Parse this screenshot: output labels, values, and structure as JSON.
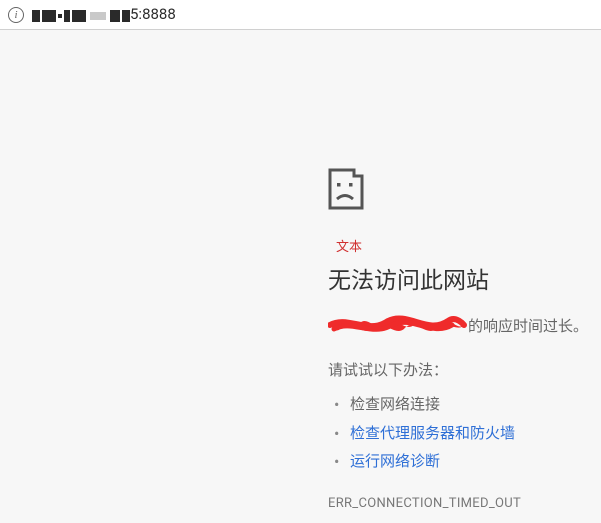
{
  "address_bar": {
    "url_suffix": "5:8888"
  },
  "annotation": {
    "label": "文本"
  },
  "error": {
    "title": "无法访问此网站",
    "message_suffix": " 的响应时间过长。",
    "try_label": "请试试以下办法：",
    "suggestions": [
      {
        "text": "检查网络连接",
        "link": false
      },
      {
        "text": "检查代理服务器和防火墙",
        "link": true
      },
      {
        "text": "运行网络诊断",
        "link": true
      }
    ],
    "code": "ERR_CONNECTION_TIMED_OUT"
  }
}
